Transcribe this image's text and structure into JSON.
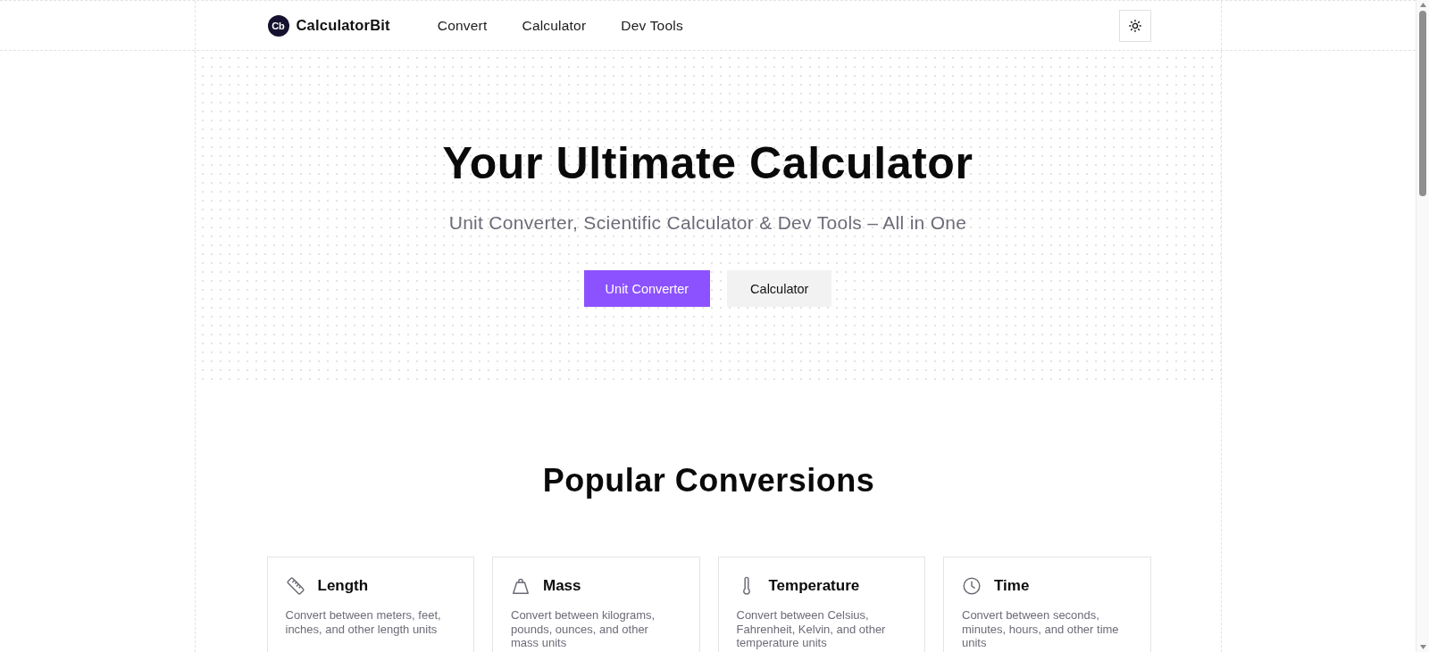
{
  "header": {
    "logo_mark": "Cb",
    "brand": "CalculatorBit",
    "nav": [
      "Convert",
      "Calculator",
      "Dev Tools"
    ]
  },
  "hero": {
    "title": "Your Ultimate Calculator",
    "subtitle": "Unit Converter, Scientific Calculator & Dev Tools – All in One",
    "buttons": [
      {
        "label": "Unit Converter",
        "kind": "primary"
      },
      {
        "label": "Calculator",
        "kind": "secondary"
      }
    ]
  },
  "popular_conversions": {
    "title": "Popular Conversions",
    "cards": [
      {
        "kind": "length",
        "title": "Length",
        "description": "Convert between meters, feet, inches, and other length units"
      },
      {
        "kind": "mass",
        "title": "Mass",
        "description": "Convert between kilograms, pounds, ounces, and other mass units"
      },
      {
        "kind": "temperature",
        "title": "Temperature",
        "description": "Convert between Celsius, Fahrenheit, Kelvin, and other temperature units"
      },
      {
        "kind": "time",
        "title": "Time",
        "description": "Convert between seconds, minutes, hours, and other time units"
      }
    ]
  }
}
